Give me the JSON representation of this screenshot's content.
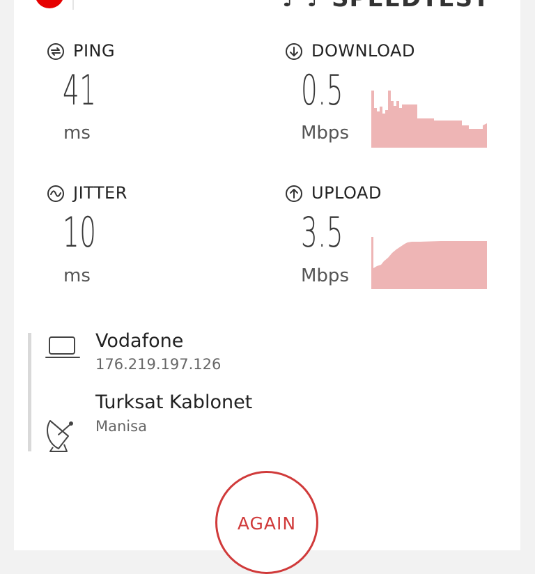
{
  "header": {
    "brand": "♪ ♪ SPEEDTEST"
  },
  "metrics": {
    "ping": {
      "label": "PING",
      "value": "41",
      "unit": "ms"
    },
    "download": {
      "label": "DOWNLOAD",
      "value": "0.5",
      "unit": "Mbps"
    },
    "jitter": {
      "label": "JITTER",
      "value": "10",
      "unit": "ms"
    },
    "upload": {
      "label": "UPLOAD",
      "value": "3.5",
      "unit": "Mbps"
    }
  },
  "provider": {
    "name": "Vodafone",
    "ip": "176.219.197.126"
  },
  "server": {
    "name": "Turksat Kablonet",
    "location": "Manisa"
  },
  "actions": {
    "again_label": "AGAIN"
  },
  "colors": {
    "accent": "#d03a3a",
    "graph_fill": "#eeb5b5",
    "logo": "#e60000"
  },
  "icons": {
    "ping": "ping-icon",
    "download": "download-arrow-icon",
    "jitter": "jitter-wave-icon",
    "upload": "upload-arrow-icon",
    "provider": "laptop-icon",
    "server": "satellite-dish-icon"
  }
}
